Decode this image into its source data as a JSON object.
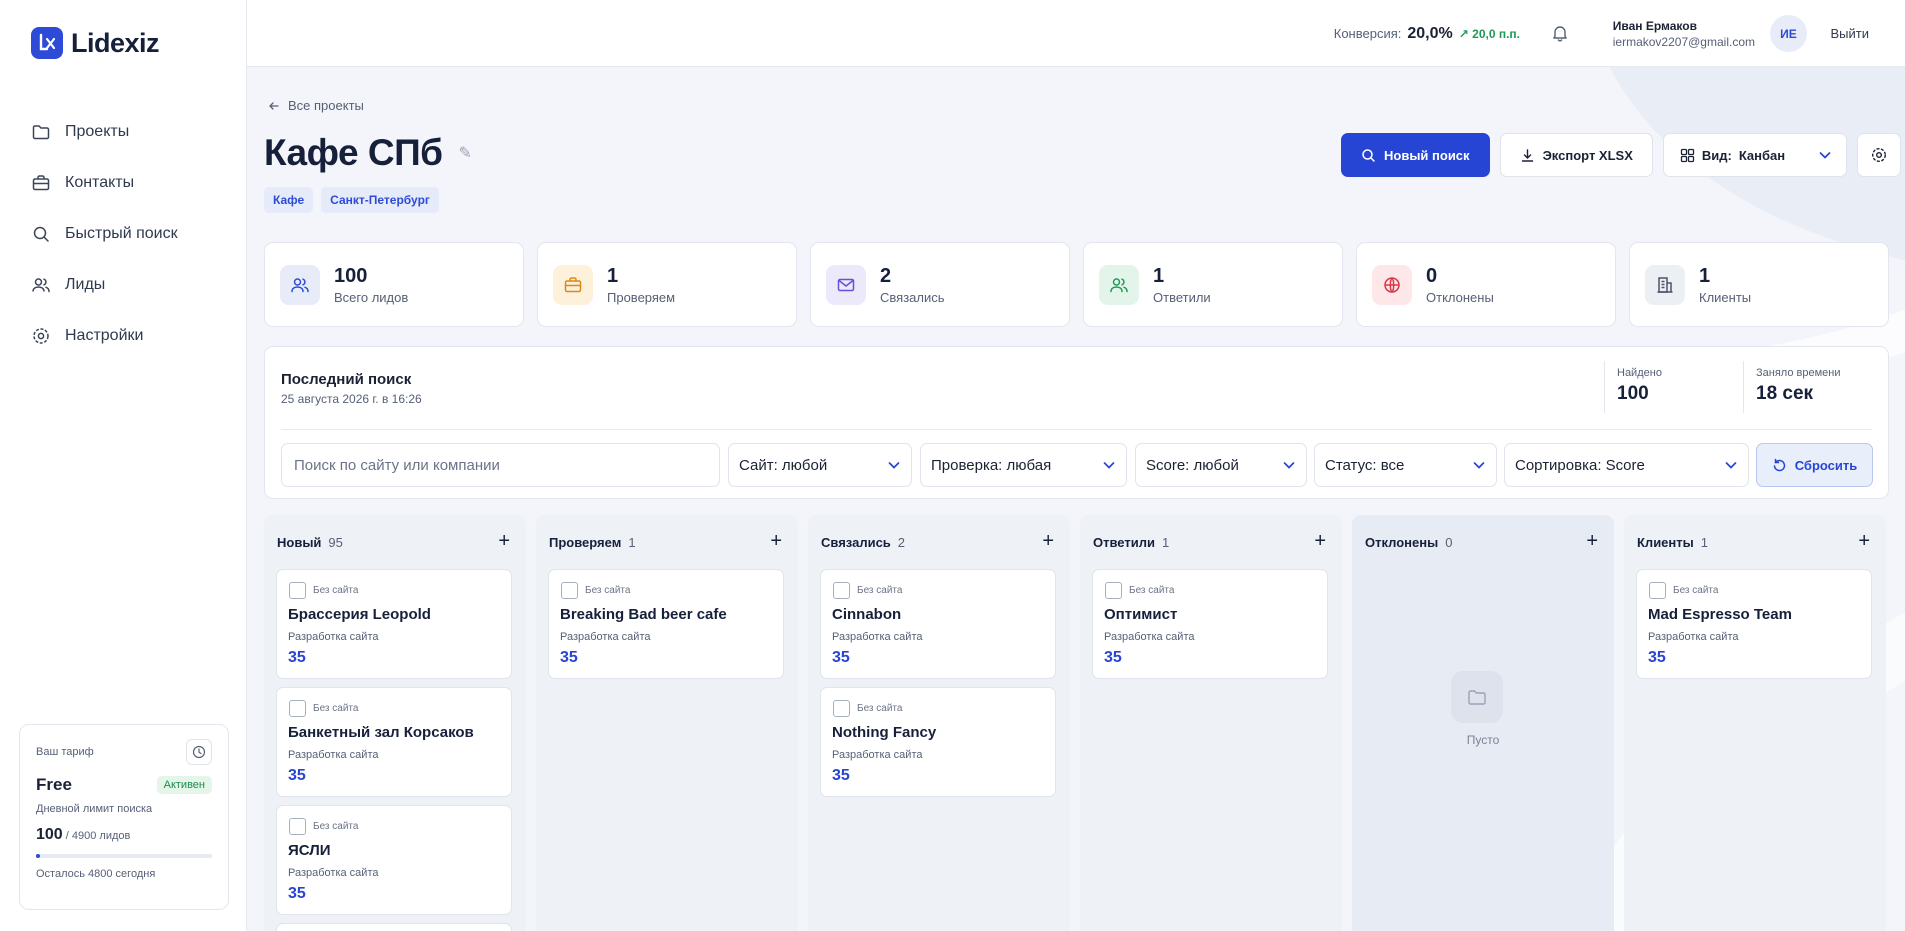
{
  "app": {
    "logo_text": "Lidexiz"
  },
  "sidebar": {
    "items": [
      {
        "label": "Проекты",
        "icon": "folder-icon"
      },
      {
        "label": "Контакты",
        "icon": "briefcase-icon"
      },
      {
        "label": "Быстрый поиск",
        "icon": "search-icon"
      },
      {
        "label": "Лиды",
        "icon": "users-icon"
      },
      {
        "label": "Настройки",
        "icon": "gear-icon"
      }
    ],
    "plan": {
      "label": "Ваш тариф",
      "name": "Free",
      "badge": "Активен",
      "limit_label": "Дневной лимит поиска",
      "used": "100",
      "total": "/ 4900 лидов",
      "used_fraction": 0.02,
      "remaining": "Осталось 4800 сегодня"
    }
  },
  "header": {
    "conversion_label": "Конверсия:",
    "conversion_value": "20,0%",
    "conversion_delta": "↗ 20,0 п.п.",
    "user_name": "Иван Ермаков",
    "user_email": "iermakov2207@gmail.com",
    "avatar_initials": "ИЕ",
    "logout": "Выйти"
  },
  "page": {
    "back_label": "Все проекты",
    "title": "Кафе СПб",
    "tags": [
      "Кафе",
      "Санкт-Петербург"
    ],
    "actions": {
      "new_search": "Новый поиск",
      "export": "Экспорт XLSX",
      "view_label": "Вид:",
      "view_value": "Канбан"
    }
  },
  "stats": [
    {
      "value": "100",
      "label": "Всего лидов",
      "icon": "users-icon",
      "bg": "#e8ecf9",
      "color": "#2d4bd6"
    },
    {
      "value": "1",
      "label": "Проверяем",
      "icon": "briefcase-icon",
      "bg": "#fdf1dc",
      "color": "#d98a13"
    },
    {
      "value": "2",
      "label": "Связались",
      "icon": "mail-icon",
      "bg": "#ece9fb",
      "color": "#6a4fd8"
    },
    {
      "value": "1",
      "label": "Ответили",
      "icon": "users-icon",
      "bg": "#e3f5ea",
      "color": "#1f9a55"
    },
    {
      "value": "0",
      "label": "Отклонены",
      "icon": "globe-icon",
      "bg": "#fde7e9",
      "color": "#d93848"
    },
    {
      "value": "1",
      "label": "Клиенты",
      "icon": "building-icon",
      "bg": "#eceff4",
      "color": "#4b5568"
    }
  ],
  "search_panel": {
    "title": "Последний поиск",
    "date": "25 августа 2026 г. в 16:26",
    "found_label": "Найдено",
    "found_value": "100",
    "took_label": "Заняло времени",
    "took_value": "18 сек",
    "placeholder": "Поиск по сайту или компании",
    "filters": [
      "Сайт: любой",
      "Проверка: любая",
      "Score: любой",
      "Статус: все",
      "Сортировка: Score"
    ],
    "reset": "Сбросить"
  },
  "kanban": {
    "columns": [
      {
        "title": "Новый",
        "count": "95",
        "cards": [
          {
            "site": "Без сайта",
            "name": "Брассерия Leopold",
            "sub": "Разработка сайта",
            "score": "35"
          },
          {
            "site": "Без сайта",
            "name": "Банкетный зал Корсаков",
            "sub": "Разработка сайта",
            "score": "35"
          },
          {
            "site": "Без сайта",
            "name": "ЯСЛИ",
            "sub": "Разработка сайта",
            "score": "35"
          }
        ]
      },
      {
        "title": "Проверяем",
        "count": "1",
        "cards": [
          {
            "site": "Без сайта",
            "name": "Breaking Bad beer cafe",
            "sub": "Разработка сайта",
            "score": "35"
          }
        ]
      },
      {
        "title": "Связались",
        "count": "2",
        "cards": [
          {
            "site": "Без сайта",
            "name": "Cinnabon",
            "sub": "Разработка сайта",
            "score": "35"
          },
          {
            "site": "Без сайта",
            "name": "Nothing Fancy",
            "sub": "Разработка сайта",
            "score": "35"
          }
        ]
      },
      {
        "title": "Ответили",
        "count": "1",
        "cards": [
          {
            "site": "Без сайта",
            "name": "Оптимист",
            "sub": "Разработка сайта",
            "score": "35"
          }
        ]
      },
      {
        "title": "Отклонены",
        "count": "0",
        "empty_text": "Пусто",
        "cards": []
      },
      {
        "title": "Клиенты",
        "count": "1",
        "cards": [
          {
            "site": "Без сайта",
            "name": "Mad Espresso Team",
            "sub": "Разработка сайта",
            "score": "35"
          }
        ]
      }
    ]
  }
}
